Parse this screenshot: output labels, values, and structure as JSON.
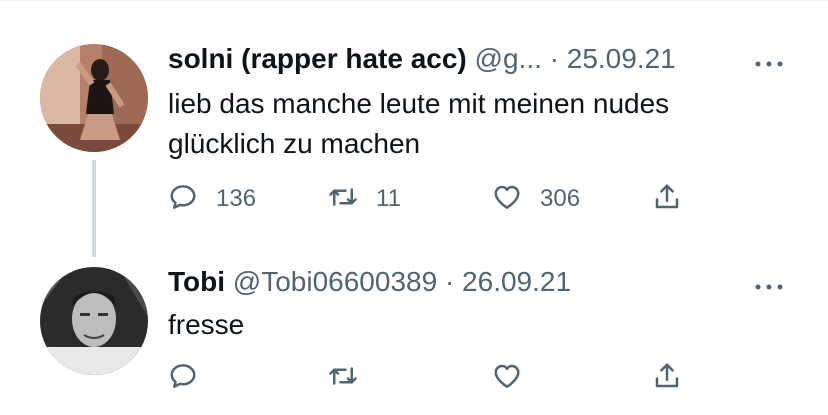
{
  "tweets": [
    {
      "name": "solni (rapper hate acc)",
      "handle_date": " @g... · 25.09.21",
      "text": "lieb das manche leute mit meinen nudes\nglücklich zu machen",
      "replies": "136",
      "retweets": "11",
      "likes": "306"
    },
    {
      "name": "Tobi",
      "handle_date": " @Tobi06600389 · 26.09.21",
      "text": "fresse",
      "replies": "",
      "retweets": "",
      "likes": ""
    }
  ],
  "colors": {
    "text_primary": "#0f1419",
    "text_secondary": "#536471",
    "thread_line": "#cfd9de"
  },
  "icons": [
    "reply-icon",
    "retweet-icon",
    "like-icon",
    "share-icon",
    "more-icon"
  ]
}
